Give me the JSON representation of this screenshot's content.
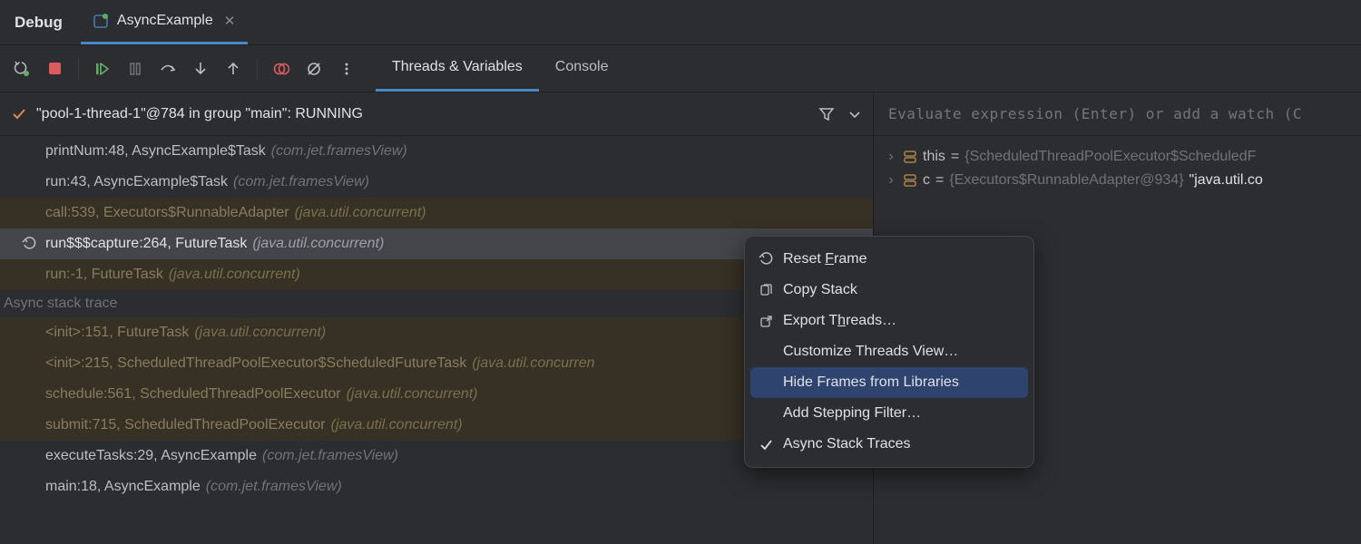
{
  "header": {
    "title": "Debug",
    "tab_label": "AsyncExample"
  },
  "tabs": {
    "threads_vars": "Threads & Variables",
    "console": "Console"
  },
  "thread": {
    "label": "\"pool-1-thread-1\"@784 in group \"main\": RUNNING"
  },
  "section": {
    "async_trace": "Async stack trace"
  },
  "frames": [
    {
      "text": "printNum:48, AsyncExample$Task",
      "pkg": "(com.jet.framesView)",
      "lib": false,
      "selected": false,
      "reset": false
    },
    {
      "text": "run:43, AsyncExample$Task",
      "pkg": "(com.jet.framesView)",
      "lib": false,
      "selected": false,
      "reset": false
    },
    {
      "text": "call:539, Executors$RunnableAdapter",
      "pkg": "(java.util.concurrent)",
      "lib": true,
      "selected": false,
      "reset": false
    },
    {
      "text": "run$$$capture:264, FutureTask",
      "pkg": "(java.util.concurrent)",
      "lib": false,
      "selected": true,
      "reset": true
    },
    {
      "text": "run:-1, FutureTask",
      "pkg": "(java.util.concurrent)",
      "lib": true,
      "selected": false,
      "reset": false
    }
  ],
  "frames_async": [
    {
      "text": "<init>:151, FutureTask",
      "pkg": "(java.util.concurrent)",
      "lib": true
    },
    {
      "text": "<init>:215, ScheduledThreadPoolExecutor$ScheduledFutureTask",
      "pkg": "(java.util.concurren",
      "lib": true
    },
    {
      "text": "schedule:561, ScheduledThreadPoolExecutor",
      "pkg": "(java.util.concurrent)",
      "lib": true
    },
    {
      "text": "submit:715, ScheduledThreadPoolExecutor",
      "pkg": "(java.util.concurrent)",
      "lib": true
    },
    {
      "text": "executeTasks:29, AsyncExample",
      "pkg": "(com.jet.framesView)",
      "lib": false
    },
    {
      "text": "main:18, AsyncExample",
      "pkg": "(com.jet.framesView)",
      "lib": false
    }
  ],
  "eval": {
    "placeholder": "Evaluate expression (Enter) or add a watch (C"
  },
  "vars": [
    {
      "name": "this",
      "eq": " = ",
      "value": "{ScheduledThreadPoolExecutor$ScheduledF"
    },
    {
      "name": "c",
      "eq": " = ",
      "value": "{Executors$RunnableAdapter@934} ",
      "string": "\"java.util.co"
    }
  ],
  "context_menu": {
    "reset_frame_pre": "Reset ",
    "reset_frame_u": "F",
    "reset_frame_post": "rame",
    "copy_stack": "Copy Stack",
    "export_threads_pre": "Export T",
    "export_threads_u": "h",
    "export_threads_post": "reads…",
    "customize": "Customize Threads View…",
    "hide_frames": "Hide Frames from Libraries",
    "add_filter": "Add Stepping Filter…",
    "async_traces": "Async Stack Traces"
  }
}
